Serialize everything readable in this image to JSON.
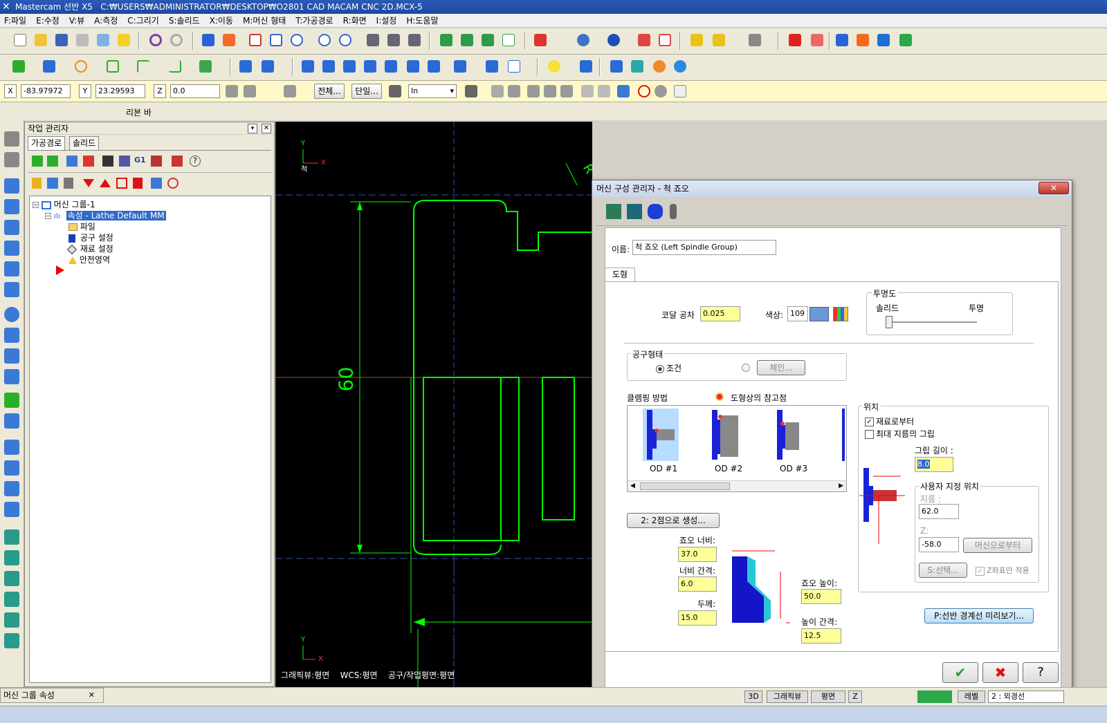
{
  "window": {
    "app": "Mastercam 선반 X5",
    "path": "C:₩USERS₩ADMINISTRATOR₩DESKTOP₩O2801 CAD MACAM CNC 2D.MCX-5"
  },
  "menu": [
    "F:파일",
    "E:수정",
    "V:뷰",
    "A:측정",
    "C:그리기",
    "S:솔리드",
    "X:이동",
    "M:머신 형태",
    "T:가공경로",
    "R:화면",
    "I:설정",
    "H:도움말"
  ],
  "coords": {
    "x_label": "X",
    "x_value": "-83.97972",
    "y_label": "Y",
    "y_value": "23.29593",
    "z_label": "Z",
    "z_value": "0.0",
    "all_btn": "전체...",
    "single_btn": "단일...",
    "unit": "In"
  },
  "ribbon_label": "리본 바",
  "opmgr": {
    "title": "작업 관리자",
    "tabs": [
      "가공경로",
      "솔리드"
    ],
    "tree": {
      "root": "머신 그룹-1",
      "props": "속성 - Lathe Default MM",
      "items": [
        "파일",
        "공구 설정",
        "재료 설정",
        "안전영역"
      ]
    }
  },
  "viewport": {
    "axis_y": "Y",
    "axis_x": "X",
    "chuck_label": "척",
    "dim_label": "60",
    "rl_label": "R",
    "status": {
      "gview": "그래픽뷰:평면",
      "wcs": "WCS:평면",
      "tplane": "공구/작업평면:평면"
    }
  },
  "dialog": {
    "title": "머신 구성 관리자 - 척 죠오",
    "name_label": "이름:",
    "name_value": "척 죠오 (Left Spindle Group)",
    "tab_label": "도형",
    "tolerance_label": "코달 공차",
    "tolerance_value": "0.025",
    "color_label": "색상:",
    "color_value": "109",
    "transparency": {
      "title": "투명도",
      "solid": "솔리드",
      "transparent": "투명"
    },
    "tool_shape": {
      "title": "공구형태",
      "option_param": "조건",
      "option_chain": "체인..."
    },
    "clamping": {
      "title": "클램핑 방법",
      "ref_label": "도형상의 참고점",
      "items": [
        "OD #1",
        "OD #2",
        "OD #3"
      ]
    },
    "position": {
      "title": "위치",
      "from_stock": "재료로부터",
      "max_dia_grip": "최대 지름의 그립",
      "grip_length_label": "그립 길이 :",
      "grip_length_value": "8.0",
      "user_pos_title": "사용자 지정 위치",
      "dia_label": "지름 :",
      "dia_value": "62.0",
      "z_label": "Z:",
      "z_value": "-58.0",
      "from_machine_btn": "머신으로부터",
      "select_btn": "S:선택...",
      "z_only_label": "Z좌표만 적용"
    },
    "create_2pt_btn": "2: 2점으로 생성...",
    "jaw": {
      "width_label": "죠오 너비:",
      "width_value": "37.0",
      "width_gap_label": "너비 간격:",
      "width_gap_value": "6.0",
      "thickness_label": "두께:",
      "thickness_value": "15.0",
      "height_label": "죠오 높이:",
      "height_value": "50.0",
      "height_gap_label": "높이 간격:",
      "height_gap_value": "12.5"
    },
    "preview_btn": "P:선반 경계선 미리보기...",
    "ok_icon": "check-icon",
    "cancel_icon": "x-icon",
    "help_icon": "question-icon"
  },
  "bottom": {
    "panel_title": "머신 그룹 속성",
    "status_3d": "3D",
    "status_gview": "그래픽뷰",
    "status_plane": "평면",
    "status_z": "Z",
    "status_level_label": "레벨",
    "status_plane2": "2 : 외경선"
  },
  "colors": {
    "accent_blue": "#3169c6",
    "geometry_green": "#00ff00",
    "highlight_yellow": "#ffff99",
    "jaw_blue": "#0000e0",
    "color_swatch": "#6a9ad6"
  }
}
